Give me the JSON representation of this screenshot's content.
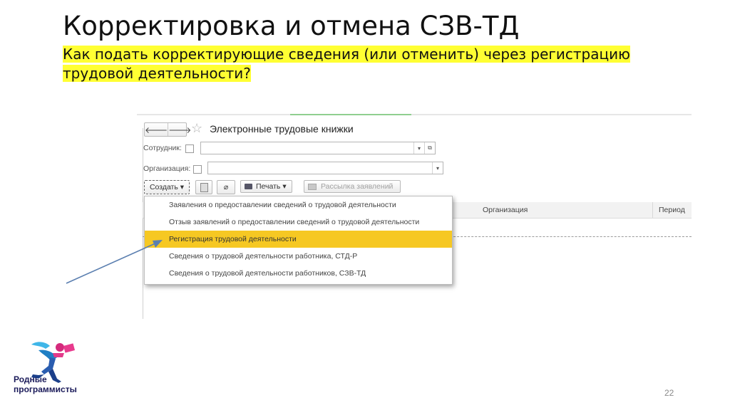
{
  "slide": {
    "title": "Корректировка и отмена СЗВ-ТД",
    "subtitle": "Как подать корректирующие сведения (или отменить) через регистрацию трудовой деятельности?",
    "page_number": "22",
    "highlight_color": "#ffff33"
  },
  "logo": {
    "line1": "Родные",
    "line2": "программисты",
    "icon": "running-figure-logo"
  },
  "app": {
    "nav": {
      "back_icon": "arrow-left-icon",
      "forward_icon": "arrow-right-icon",
      "back": "🡐",
      "forward": "🡒"
    },
    "favorite_icon": "star-icon",
    "form_title": "Электронные трудовые книжки",
    "filters": {
      "employee_label": "Сотрудник:",
      "employee_value": "",
      "organization_label": "Организация:",
      "organization_value": ""
    },
    "toolbar": {
      "create_label": "Создать",
      "print_label": "Печать",
      "mailing_label": "Рассылка заявлений"
    },
    "columns": {
      "organization": "Организация",
      "period": "Период"
    },
    "create_menu": {
      "items": [
        "Заявления о предоставлении сведений о трудовой деятельности",
        "Отзыв заявлений о предоставлении сведений о трудовой деятельности",
        "Регистрация трудовой деятельности",
        "Сведения о трудовой деятельности работника, СТД-Р",
        "Сведения о трудовой деятельности работников, СЗВ-ТД"
      ],
      "selected_index": 2,
      "selected_color": "#f6c823"
    }
  },
  "annotation": {
    "arrow_color": "#5b7fb0"
  }
}
